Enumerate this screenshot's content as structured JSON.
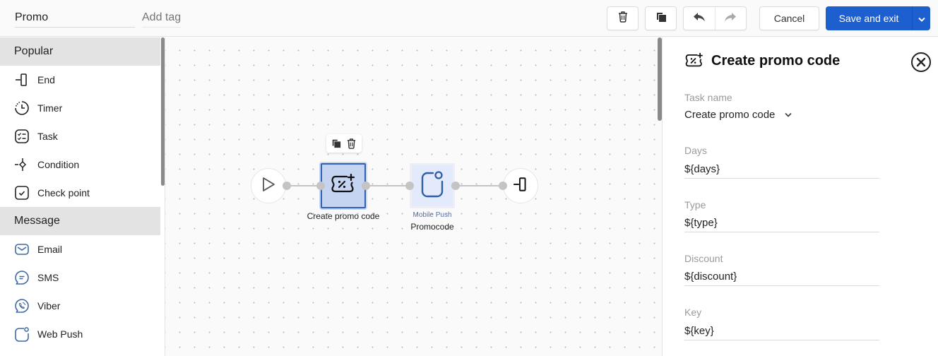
{
  "header": {
    "name_value": "Promo",
    "tag_placeholder": "Add tag",
    "buttons": {
      "delete_icon": "trash-icon",
      "copy_icon": "copy-icon",
      "undo_icon": "undo-icon",
      "redo_icon": "redo-icon",
      "cancel_label": "Cancel",
      "save_label": "Save and exit"
    },
    "accent_color": "#1d5fcf"
  },
  "sidebar": {
    "sections": [
      {
        "title": "Popular",
        "items": [
          {
            "label": "End",
            "icon": "end-icon"
          },
          {
            "label": "Timer",
            "icon": "timer-icon"
          },
          {
            "label": "Task",
            "icon": "task-icon"
          },
          {
            "label": "Condition",
            "icon": "condition-icon"
          },
          {
            "label": "Check point",
            "icon": "checkpoint-icon"
          }
        ]
      },
      {
        "title": "Message",
        "items": [
          {
            "label": "Email",
            "icon": "email-icon"
          },
          {
            "label": "SMS",
            "icon": "sms-icon"
          },
          {
            "label": "Viber",
            "icon": "viber-icon"
          },
          {
            "label": "Web Push",
            "icon": "web-push-icon"
          }
        ]
      }
    ]
  },
  "canvas": {
    "nodes": [
      {
        "id": "start",
        "icon": "play-icon"
      },
      {
        "id": "create-promo",
        "label": "Create promo code",
        "icon": "promo-code-icon",
        "selected": true
      },
      {
        "id": "mobile-push",
        "type_label": "Mobile Push",
        "label": "Promocode",
        "icon": "mobile-push-icon"
      },
      {
        "id": "end",
        "icon": "end-icon"
      }
    ]
  },
  "panel": {
    "title": "Create promo code",
    "task_name_label": "Task name",
    "task_name_value": "Create promo code",
    "fields": [
      {
        "label": "Days",
        "value": "${days}"
      },
      {
        "label": "Type",
        "value": "${type}"
      },
      {
        "label": "Discount",
        "value": "${discount}"
      },
      {
        "label": "Key",
        "value": "${key}"
      }
    ]
  }
}
